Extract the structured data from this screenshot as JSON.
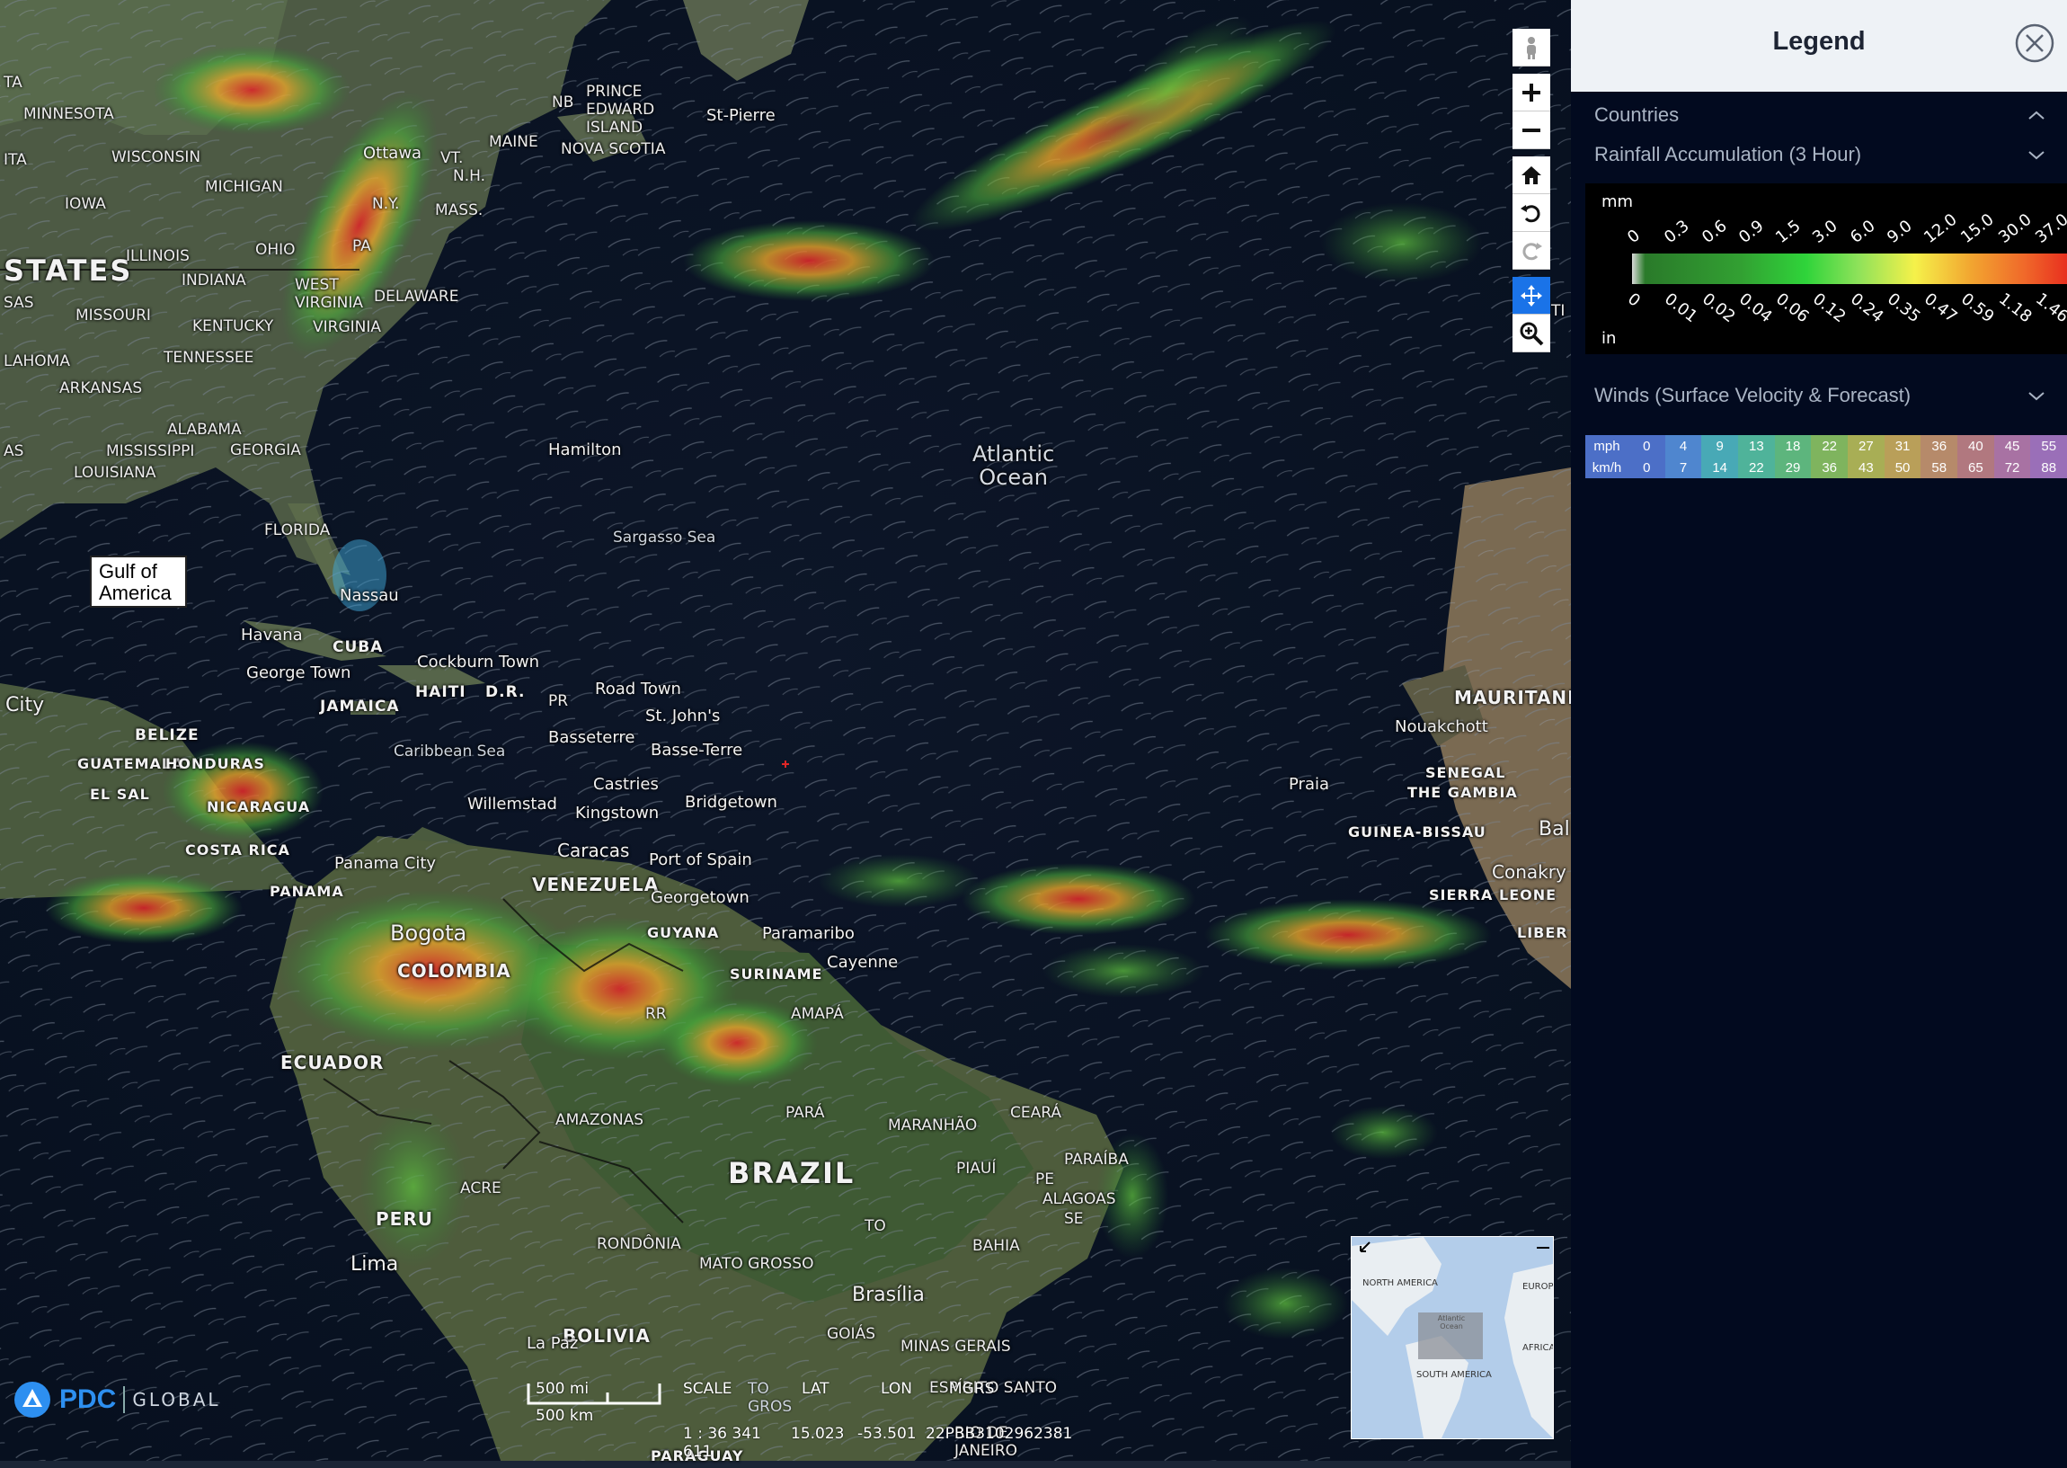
{
  "map": {
    "gulf_label": "Gulf of America",
    "labels": {
      "states_country": "STATES",
      "ta": "TA",
      "minnesota": "MINNESOTA",
      "wisconsin": "WISCONSIN",
      "michigan": "MICHIGAN",
      "iowa": "IOWA",
      "ita": "ITA",
      "illinois": "ILLINOIS",
      "ohio": "OHIO",
      "indiana": "INDIANA",
      "sas": "SAS",
      "missouri": "MISSOURI",
      "kentucky": "KENTUCKY",
      "west_virginia": "WEST VIRGINIA",
      "virginia": "VIRGINIA",
      "tennessee": "TENNESSEE",
      "lahoma": "LAHOMA",
      "arkansas": "ARKANSAS",
      "alabama": "ALABAMA",
      "mississippi": "MISSISSIPPI",
      "georgia": "GEORGIA",
      "louisiana": "LOUISIANA",
      "as": "AS",
      "florida": "FLORIDA",
      "ottawa": "Ottawa",
      "ny": "N.Y.",
      "pa": "PA",
      "mass": "MASS.",
      "vt": "VT.",
      "nh": "N.H.",
      "maine": "MAINE",
      "delaware": "DELAWARE",
      "pei": "PRINCE EDWARD ISLAND",
      "nb": "NB",
      "nova_scotia": "NOVA SCOTIA",
      "st_pierre": "St-Pierre",
      "hamilton": "Hamilton",
      "sargasso": "Sargasso Sea",
      "atlantic": "Atlantic\nOcean",
      "nassau": "Nassau",
      "havana": "Havana",
      "cuba": "CUBA",
      "george_town": "George Town",
      "cockburn": "Cockburn Town",
      "haiti": "HAITI",
      "dr": "D.R.",
      "pr": "PR",
      "road_town": "Road Town",
      "st_johns": "St. John's",
      "basseterre": "Basseterre",
      "basse_terre": "Basse-Terre",
      "jamaica": "JAMAICA",
      "caribbean": "Caribbean Sea",
      "castries": "Castries",
      "bridgetown": "Bridgetown",
      "kingstown": "Kingstown",
      "willemstad": "Willemstad",
      "city": "City",
      "belize": "BELIZE",
      "guatemala": "GUATEMALA",
      "honduras": "HONDURAS",
      "el_sal": "EL SAL",
      "nicaragua": "NICARAGUA",
      "costa_rica": "COSTA RICA",
      "panama_city": "Panama City",
      "panama": "PANAMA",
      "caracas": "Caracas",
      "venezuela": "VENEZUELA",
      "port_spain": "Port of Spain",
      "georgetown": "Georgetown",
      "guyana": "GUYANA",
      "paramaribo": "Paramaribo",
      "suriname": "SURINAME",
      "cayenne": "Cayenne",
      "amapa": "AMAPÁ",
      "rr": "RR",
      "bogota": "Bogota",
      "colombia": "COLOMBIA",
      "ecuador": "ECUADOR",
      "amazonas": "AMAZONAS",
      "para": "PARÁ",
      "maranhao": "MARANHÃO",
      "ceara": "CEARÁ",
      "piaui": "PIAUÍ",
      "paraiba": "PARAÍBA",
      "pe": "PE",
      "alagoas": "ALAGOAS",
      "se": "SE",
      "brazil": "BRAZIL",
      "acre": "ACRE",
      "peru": "PERU",
      "rondonia": "RONDÔNIA",
      "to": "TO",
      "bahia": "BAHIA",
      "mato_grosso": "MATO GROSSO",
      "brasilia": "Brasília",
      "lima": "Lima",
      "goias": "GOIÁS",
      "minas": "MINAS GERAIS",
      "espirito": "ESPÍRITO SANTO",
      "bolivia": "BOLIVIA",
      "la_paz": "La Paz",
      "rio": "RIO DE JANEIRO",
      "paraguay": "PARAGUAY",
      "mauritania": "MAURITANI",
      "nouakchott": "Nouakchott",
      "senegal": "SENEGAL",
      "gambia": "THE GAMBIA",
      "guinea_bissau": "GUINEA-BISSAU",
      "praia": "Praia",
      "bal": "Bal",
      "conakry": "Conakry",
      "sierra_leone": "SIERRA LEONE",
      "liber": "LIBER",
      "ti": "TI"
    },
    "scale": {
      "miles": "500 mi",
      "km": "500 km"
    },
    "readout": {
      "scale_label": "SCALE",
      "scale_value": "1 : 36 341 611",
      "lat_label": "LAT",
      "lat_value": "15.023",
      "lon_label": "LON",
      "lon_value": "-53.501",
      "mgrs_label": "MGRS",
      "mgrs_value": "22PBB3102962381",
      "overlap_text": "TO GROS"
    },
    "logo": {
      "pdc": "PDC",
      "global": "GLOBAL"
    },
    "overview": {
      "north_america": "NORTH AMERICA",
      "europe": "EUROP",
      "south_america": "SOUTH AMERICA",
      "africa": "AFRICA",
      "atlantic": "Atlantic Ocean"
    }
  },
  "toolbar": {
    "icons": [
      "pegman-icon",
      "zoom-in-icon",
      "zoom-out-icon",
      "home-icon",
      "rotate-left-icon",
      "rotate-right-icon",
      "pan-icon",
      "zoom-search-icon"
    ]
  },
  "legend": {
    "title": "Legend",
    "sections": {
      "countries": "Countries",
      "rainfall": "Rainfall Accumulation (3 Hour)",
      "winds": "Winds (Surface Velocity & Forecast)"
    },
    "rainfall": {
      "unit_mm": "mm",
      "unit_in": "in",
      "mm_ticks": [
        "0",
        "0.3",
        "0.6",
        "0.9",
        "1.5",
        "3.0",
        "6.0",
        "9.0",
        "12.0",
        "15.0",
        "30.0",
        "37.0"
      ],
      "in_ticks": [
        "0",
        "0.01",
        "0.02",
        "0.04",
        "0.06",
        "0.12",
        "0.24",
        "0.35",
        "0.47",
        "0.59",
        "1.18",
        "1.46"
      ]
    },
    "winds": {
      "mph_label": "mph",
      "kmh_label": "km/h",
      "mph": [
        "0",
        "4",
        "9",
        "13",
        "18",
        "22",
        "27",
        "31",
        "36",
        "40",
        "45",
        "55"
      ],
      "kmh": [
        "0",
        "7",
        "14",
        "22",
        "29",
        "36",
        "43",
        "50",
        "58",
        "65",
        "72",
        "88"
      ],
      "colors": [
        "#4c6fc7",
        "#4f86cf",
        "#48a9b6",
        "#4fb39a",
        "#5db57d",
        "#7fb45e",
        "#a8ae55",
        "#b99f59",
        "#b68a6a",
        "#b1787f",
        "#a872a3",
        "#9a6fb8"
      ]
    }
  }
}
